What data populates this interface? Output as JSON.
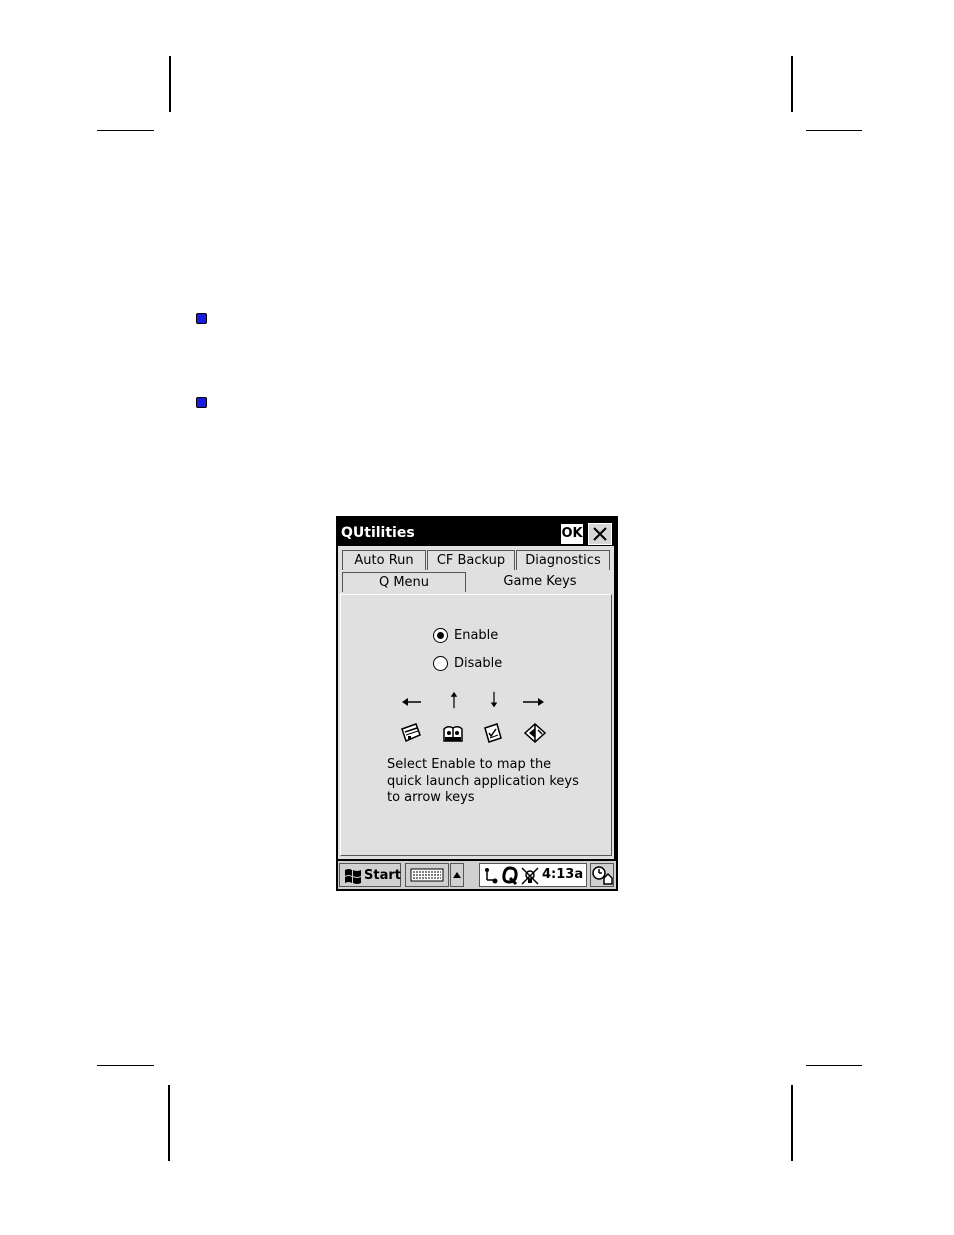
{
  "window": {
    "title": "QUtilities",
    "ok_label": "OK"
  },
  "tabs": {
    "row1": [
      "Auto Run",
      "CF Backup",
      "Diagnostics"
    ],
    "row2": [
      "Q Menu",
      "Game Keys"
    ],
    "active": "Game Keys"
  },
  "game_keys": {
    "enable_label": "Enable",
    "disable_label": "Disable",
    "selected": "Enable",
    "help_text": [
      "Select Enable to map the",
      "quick launch application keys",
      "to arrow keys"
    ]
  },
  "taskbar": {
    "start_label": "Start",
    "clock": "4:13a"
  },
  "icons": {
    "arrows": [
      "arrow-left-icon",
      "arrow-up-icon",
      "arrow-down-icon",
      "arrow-right-icon"
    ],
    "apps": [
      "calendar-app-icon",
      "contacts-app-icon",
      "tasks-app-icon",
      "notes-app-icon"
    ]
  },
  "colors": {
    "bullet": "#1a1ae0",
    "titlebar": "#000000",
    "panel": "#e0e0e0"
  }
}
